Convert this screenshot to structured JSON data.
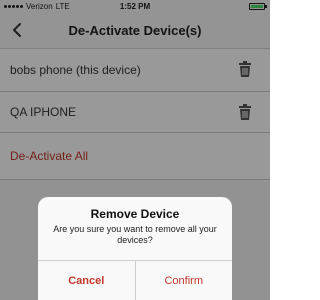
{
  "status_bar": {
    "carrier": "Verizon",
    "network": "LTE",
    "time": "1:52 PM"
  },
  "nav": {
    "title": "De-Activate Device(s)",
    "back_icon": "chevron-left-icon"
  },
  "devices": [
    {
      "name": "bobs phone (this device)",
      "icon": "trash-icon"
    },
    {
      "name": "QA IPHONE",
      "icon": "trash-icon"
    }
  ],
  "deactivate_all_label": "De-Activate All",
  "dialog": {
    "title": "Remove Device",
    "message": "Are you sure you want to remove all your devices?",
    "cancel_label": "Cancel",
    "confirm_label": "Confirm"
  },
  "colors": {
    "accent_red": "#c0392b",
    "battery_green": "#4cd964"
  }
}
